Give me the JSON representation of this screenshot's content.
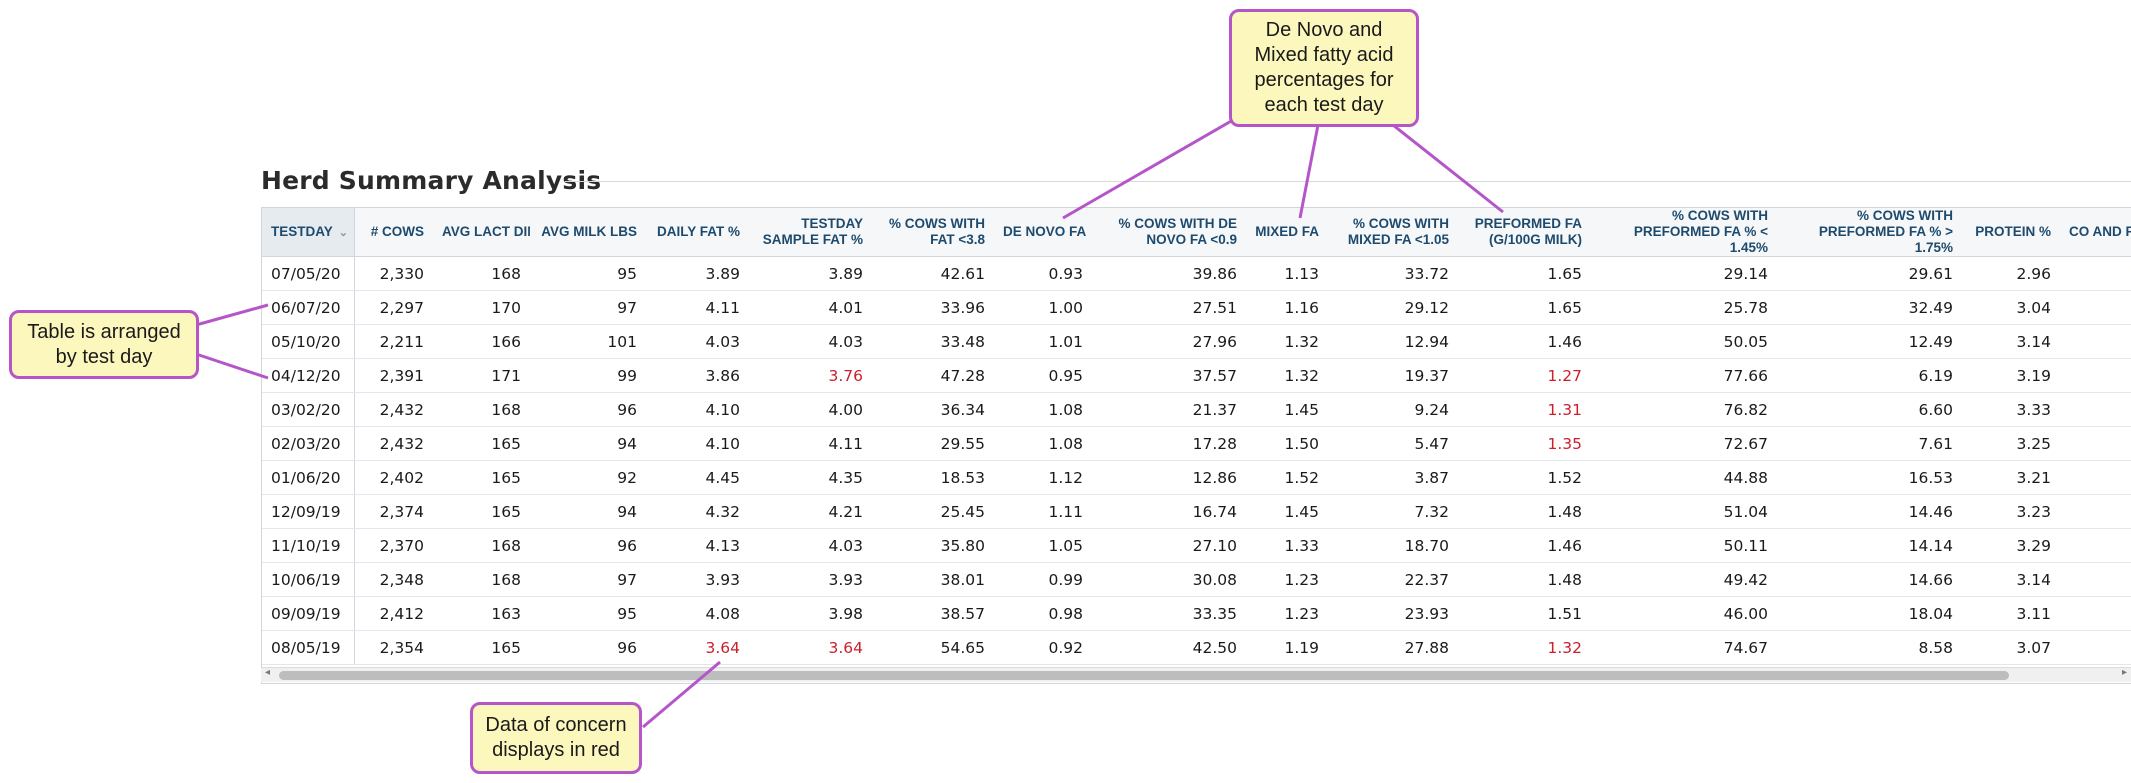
{
  "page_title": "Herd Summary Analysis",
  "columns": [
    {
      "label": "TESTDAY",
      "sortable": true
    },
    {
      "label": "# COWS"
    },
    {
      "label": "AVG LACT DIM"
    },
    {
      "label": "AVG MILK LBS"
    },
    {
      "label": "DAILY FAT %"
    },
    {
      "label": "TESTDAY SAMPLE FAT %"
    },
    {
      "label": "% COWS WITH FAT <3.8"
    },
    {
      "label": "DE NOVO FA"
    },
    {
      "label": "% COWS WITH DE NOVO FA <0.9"
    },
    {
      "label": "MIXED FA"
    },
    {
      "label": "% COWS WITH MIXED FA <1.05"
    },
    {
      "label": "PREFORMED FA (G/100G MILK)"
    },
    {
      "label": "% COWS WITH PREFORMED FA % < 1.45%"
    },
    {
      "label": "% COWS WITH PREFORMED FA % > 1.75%"
    },
    {
      "label": "PROTEIN %"
    },
    {
      "label": "CO AND PR"
    }
  ],
  "rows": [
    {
      "cells": [
        "07/05/20",
        "2,330",
        "168",
        "95",
        "3.89",
        "3.89",
        "42.61",
        "0.93",
        "39.86",
        "1.13",
        "33.72",
        "1.65",
        "29.14",
        "29.61",
        "2.96",
        ""
      ],
      "red": []
    },
    {
      "cells": [
        "06/07/20",
        "2,297",
        "170",
        "97",
        "4.11",
        "4.01",
        "33.96",
        "1.00",
        "27.51",
        "1.16",
        "29.12",
        "1.65",
        "25.78",
        "32.49",
        "3.04",
        ""
      ],
      "red": []
    },
    {
      "cells": [
        "05/10/20",
        "2,211",
        "166",
        "101",
        "4.03",
        "4.03",
        "33.48",
        "1.01",
        "27.96",
        "1.32",
        "12.94",
        "1.46",
        "50.05",
        "12.49",
        "3.14",
        ""
      ],
      "red": []
    },
    {
      "cells": [
        "04/12/20",
        "2,391",
        "171",
        "99",
        "3.86",
        "3.76",
        "47.28",
        "0.95",
        "37.57",
        "1.32",
        "19.37",
        "1.27",
        "77.66",
        "6.19",
        "3.19",
        ""
      ],
      "red": [
        5,
        11
      ]
    },
    {
      "cells": [
        "03/02/20",
        "2,432",
        "168",
        "96",
        "4.10",
        "4.00",
        "36.34",
        "1.08",
        "21.37",
        "1.45",
        "9.24",
        "1.31",
        "76.82",
        "6.60",
        "3.33",
        ""
      ],
      "red": [
        11
      ]
    },
    {
      "cells": [
        "02/03/20",
        "2,432",
        "165",
        "94",
        "4.10",
        "4.11",
        "29.55",
        "1.08",
        "17.28",
        "1.50",
        "5.47",
        "1.35",
        "72.67",
        "7.61",
        "3.25",
        ""
      ],
      "red": [
        11
      ]
    },
    {
      "cells": [
        "01/06/20",
        "2,402",
        "165",
        "92",
        "4.45",
        "4.35",
        "18.53",
        "1.12",
        "12.86",
        "1.52",
        "3.87",
        "1.52",
        "44.88",
        "16.53",
        "3.21",
        ""
      ],
      "red": []
    },
    {
      "cells": [
        "12/09/19",
        "2,374",
        "165",
        "94",
        "4.32",
        "4.21",
        "25.45",
        "1.11",
        "16.74",
        "1.45",
        "7.32",
        "1.48",
        "51.04",
        "14.46",
        "3.23",
        ""
      ],
      "red": []
    },
    {
      "cells": [
        "11/10/19",
        "2,370",
        "168",
        "96",
        "4.13",
        "4.03",
        "35.80",
        "1.05",
        "27.10",
        "1.33",
        "18.70",
        "1.46",
        "50.11",
        "14.14",
        "3.29",
        ""
      ],
      "red": []
    },
    {
      "cells": [
        "10/06/19",
        "2,348",
        "168",
        "97",
        "3.93",
        "3.93",
        "38.01",
        "0.99",
        "30.08",
        "1.23",
        "22.37",
        "1.48",
        "49.42",
        "14.66",
        "3.14",
        ""
      ],
      "red": []
    },
    {
      "cells": [
        "09/09/19",
        "2,412",
        "163",
        "95",
        "4.08",
        "3.98",
        "38.57",
        "0.98",
        "33.35",
        "1.23",
        "23.93",
        "1.51",
        "46.00",
        "18.04",
        "3.11",
        ""
      ],
      "red": []
    },
    {
      "cells": [
        "08/05/19",
        "2,354",
        "165",
        "96",
        "3.64",
        "3.64",
        "54.65",
        "0.92",
        "42.50",
        "1.19",
        "27.88",
        "1.32",
        "74.67",
        "8.58",
        "3.07",
        ""
      ],
      "red": [
        4,
        5,
        11
      ]
    }
  ],
  "callouts": {
    "test_day": "Table is arranged by test day",
    "fatty_acid": "De Novo and Mixed fatty acid percentages for each test day",
    "concern": "Data of concern displays in red"
  },
  "colors": {
    "header_text": "#1e4a6d",
    "concern_red": "#cc1f2b",
    "callout_fill": "#fbf7bd",
    "callout_border": "#b555c9"
  },
  "icons": {
    "sort": "chevron-down-icon",
    "scroll_left": "arrow-left-icon",
    "scroll_right": "arrow-right-icon"
  }
}
